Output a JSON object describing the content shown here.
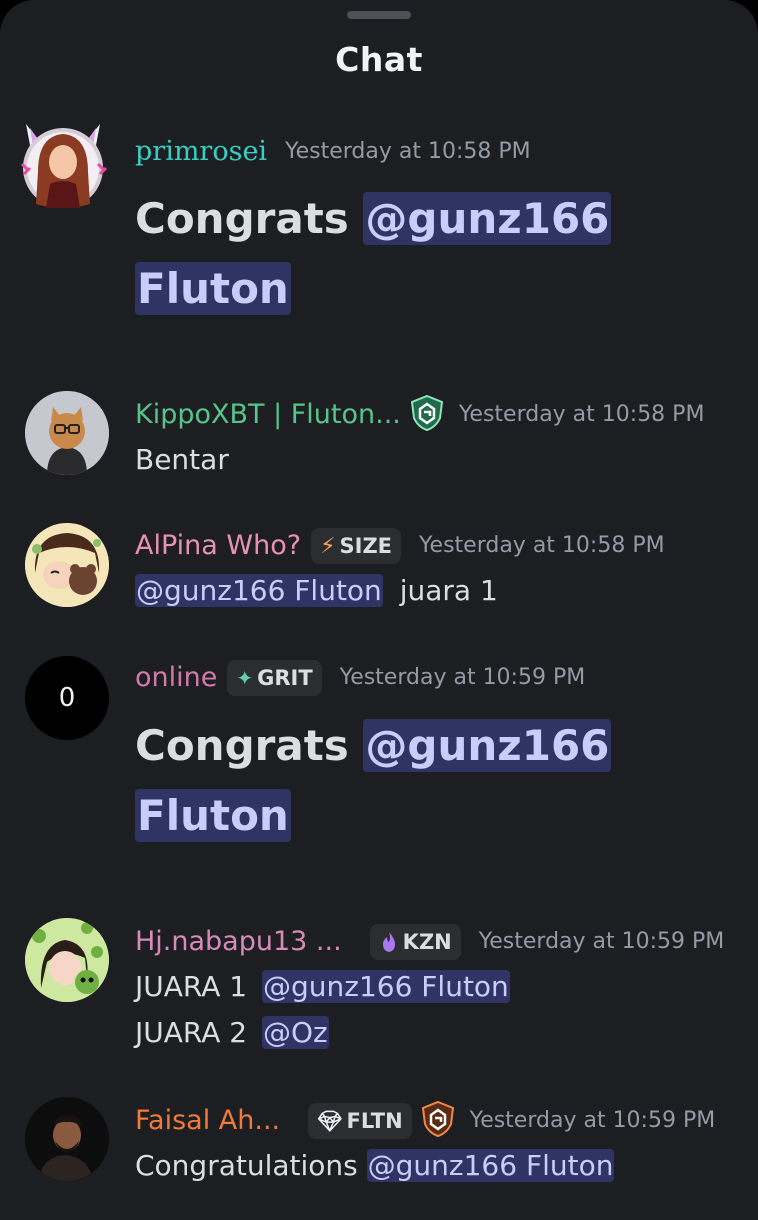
{
  "header": {
    "title": "Chat"
  },
  "messages": [
    {
      "username": "primrosei",
      "timestamp": "Yesterday at 10:58 PM",
      "text_prefix": "Congrats ",
      "mention_line1": "@gunz166",
      "mention_line2": "Fluton",
      "name_color": "#36d1c4"
    },
    {
      "username": "KippoXBT | Fluton...",
      "timestamp": "Yesterday at 10:58 PM",
      "text": "Bentar",
      "name_color": "#57c48a"
    },
    {
      "username": "AlPina Who?",
      "badge_label": "SIZE",
      "timestamp": "Yesterday at 10:58 PM",
      "mention": "@gunz166 Fluton",
      "text_suffix": " juara 1",
      "name_color": "#e691b3"
    },
    {
      "username": "online",
      "avatar_letter": "0",
      "badge_label": "GRIT",
      "timestamp": "Yesterday at 10:59 PM",
      "text_prefix": "Congrats ",
      "mention_line1": "@gunz166",
      "mention_line2": "Fluton",
      "name_color": "#d17aa8"
    },
    {
      "username": "Hj.nabapu13 ...",
      "badge_label": "KZN",
      "timestamp": "Yesterday at 10:59 PM",
      "line1_prefix": "JUARA 1 ",
      "line1_mention": "@gunz166 Fluton",
      "line2_prefix": "JUARA 2 ",
      "line2_mention": "@Oz",
      "name_color": "#d88ab8"
    },
    {
      "username": "Faisal Ah...",
      "badge_label": "FLTN",
      "timestamp": "Yesterday at 10:59 PM",
      "text_prefix": "Congratulations ",
      "mention": "@gunz166 Fluton",
      "name_color": "#f07a3a"
    }
  ]
}
